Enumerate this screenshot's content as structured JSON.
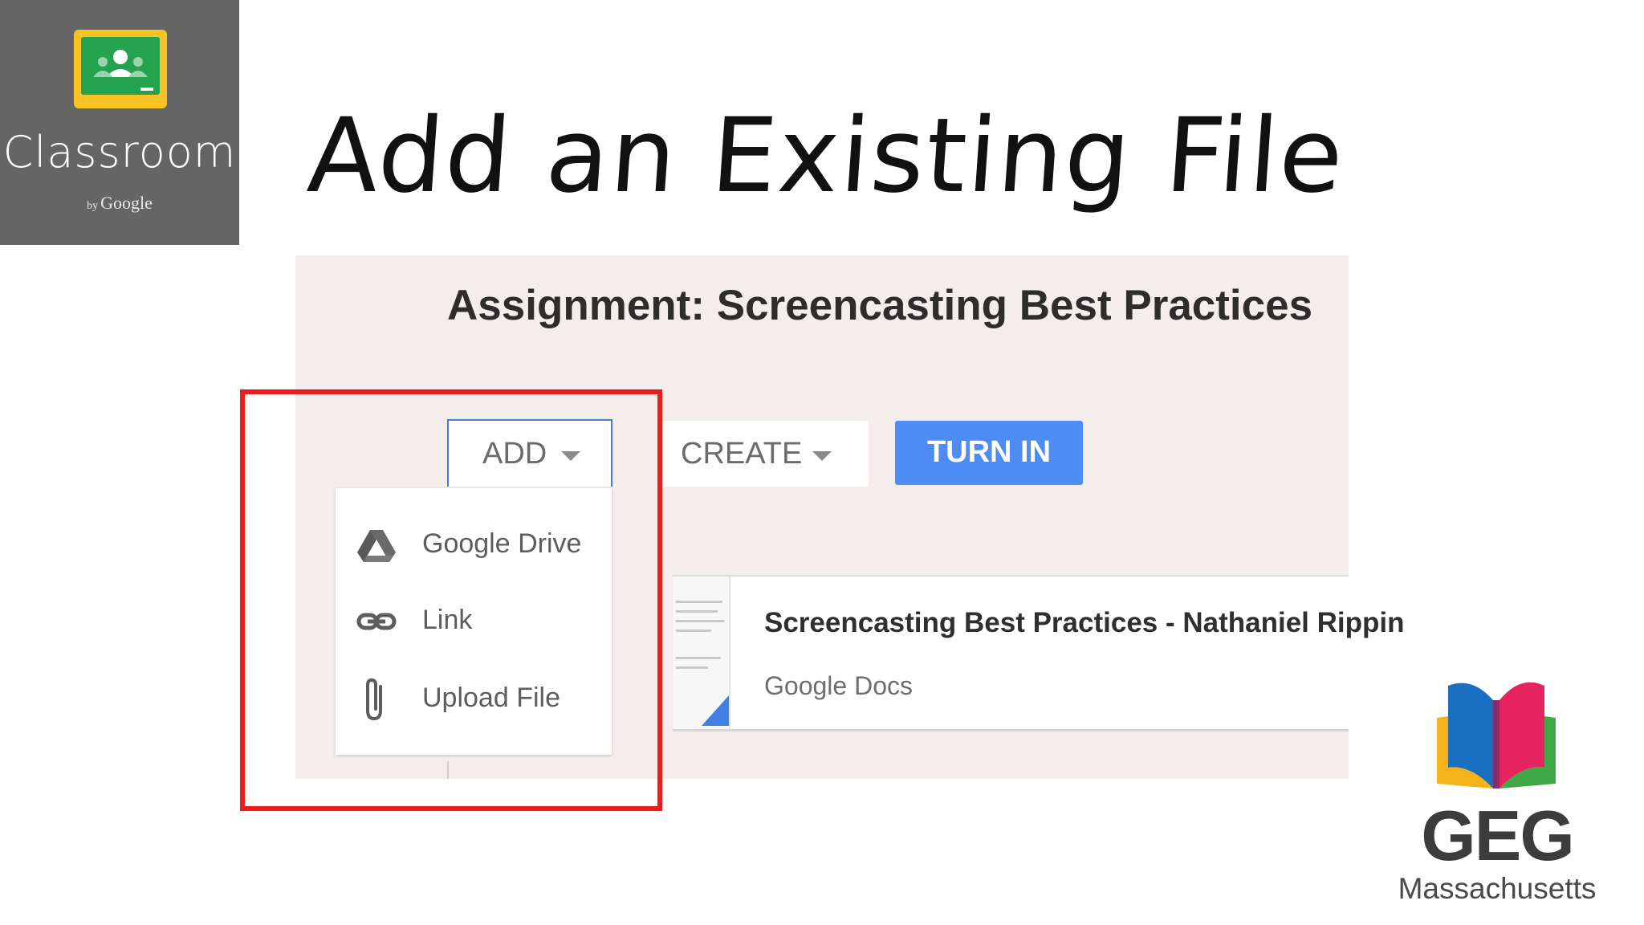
{
  "logo": {
    "title": "Classroom",
    "by": "by",
    "brand": "Google"
  },
  "slide": {
    "title": "Add an Existing File"
  },
  "assignment": {
    "title": "Assignment: Screencasting Best Practices",
    "buttons": {
      "add": "ADD",
      "create": "CREATE",
      "turn_in": "TURN IN"
    }
  },
  "add_menu": {
    "items": [
      {
        "label": "Google Drive",
        "icon": "google-drive-icon"
      },
      {
        "label": "Link",
        "icon": "link-icon"
      },
      {
        "label": "Upload File",
        "icon": "paperclip-icon"
      }
    ]
  },
  "attachment": {
    "title": "Screencasting Best Practices - Nathaniel Rippin",
    "type": "Google Docs"
  },
  "geg": {
    "name": "GEG",
    "region": "Massachusetts"
  },
  "colors": {
    "highlight": "#ef1b1b",
    "turn_in": "#4d8cf5",
    "classroom_green": "#25a24e",
    "classroom_yellow": "#f7c325"
  }
}
